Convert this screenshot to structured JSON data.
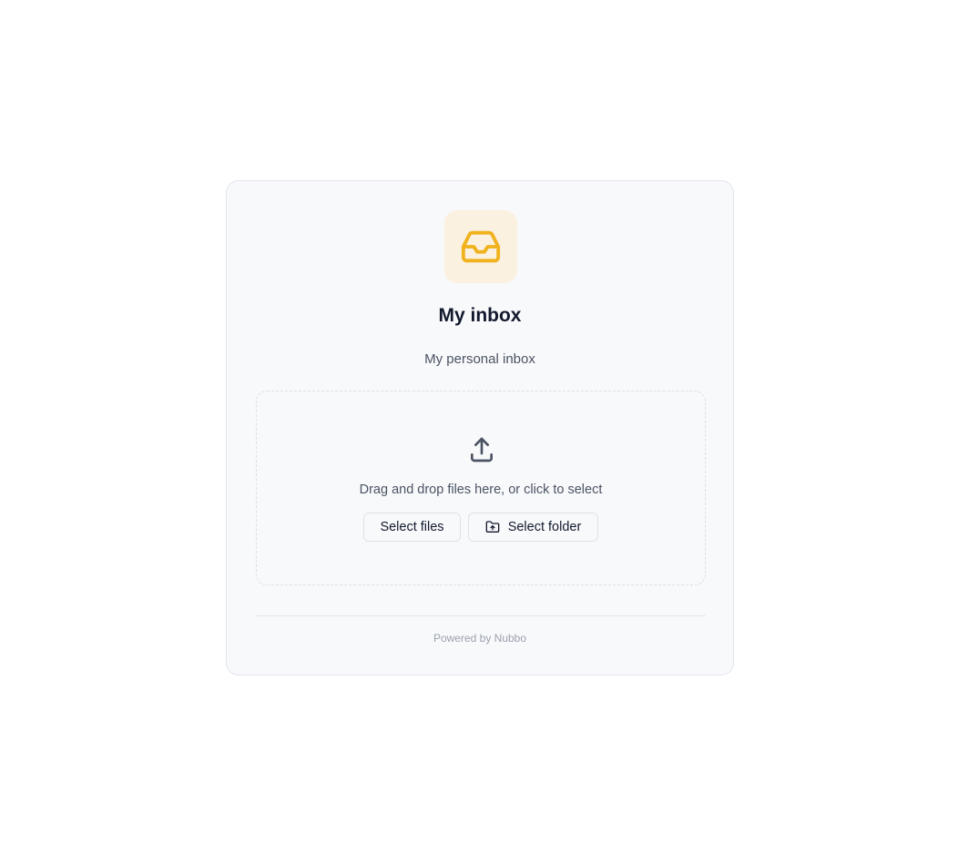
{
  "inbox": {
    "icon": "inbox-icon",
    "icon_color": "#f0b21d",
    "icon_background": "#fbf1e1",
    "title": "My inbox",
    "description": "My personal inbox"
  },
  "dropzone": {
    "icon": "upload-icon",
    "text": "Drag and drop files here, or click to select",
    "select_files_label": "Select files",
    "select_folder_label": "Select folder",
    "select_folder_icon": "folder-upload-icon"
  },
  "footer": {
    "powered_by": "Powered by Nubbo"
  }
}
